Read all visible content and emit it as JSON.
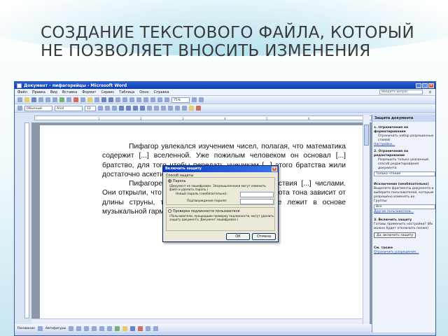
{
  "slide": {
    "title": "СОЗДАНИЕ ТЕКСТОВОГО ФАЙЛА, КОТОРЫЙ\nНЕ ПОЗВОЛЯЕТ ВНОСИТЬ ИЗМЕНЕНИЯ"
  },
  "word": {
    "window_title": "Документ - пифагорейцы - Microsoft Word",
    "menu": [
      "Файл",
      "Правка",
      "Вид",
      "Вставка",
      "Формат",
      "Сервис",
      "Таблица",
      "Окно",
      "Справка"
    ],
    "help_box": "Введите вопрос",
    "toolbar": {
      "zoom": "75%",
      "style": "Обычный",
      "font": "Arial",
      "size": "12"
    },
    "document_paragraphs": [
      "Пифагор увлекался изучением чисел, полагая, что математика содержит [...] вселенной. Уже пожилым человеком он основал [...] братство, для того чтобы передать ученикам [...] этого братства жили достаточно аскетично [...] занимались математикой.",
      "Пифагорейцы [...] и умели выполнять действия [...] числами. Они открыли, что в струнных инструментах [...] высота тона зависит от длины струны, т.е. математическое соотношение лежит в основе музыкальной гармонии."
    ],
    "drawing_bar": {
      "draw_label": "Рисование",
      "autoshapes_label": "Автофигуры"
    }
  },
  "task_pane": {
    "title": "Защита документа",
    "section1": "1. Ограничения на форматирование",
    "section1_checkbox": "Ограничить набор разрешенных стилей",
    "section1_link": "Настройки...",
    "section2": "2. Ограничения на редактирование",
    "section2_checkbox": "Разрешить только указанный способ редактирования документа:",
    "section2_select": "Только чтение",
    "exceptions_title": "Исключения (необязательно)",
    "exceptions_text": "Выделите фрагменты документа и выберите пользователей, которым разрешено изменять их.",
    "groups_label": "Группы:",
    "group_everyone": "Все",
    "more_users_link": "Другие пользователи...",
    "section3": "3. Включить защиту",
    "section3_text": "Готовы применить настройки? (Их можно будет отключить позже)",
    "enforce_button": "Да, включить защиту",
    "see_also": "См. также",
    "restrict_link": "Ограничить разрешения..."
  },
  "dialog": {
    "title": "Включить защиту",
    "group_label": "Способ защиты",
    "option_password": "Пароль",
    "password_note": "(Документ не зашифрован. Злоумышленники могут изменить файл и удалить пароль.)",
    "new_password_label": "Новый пароль (необязательно):",
    "confirm_password_label": "Подтверждение пароля:",
    "option_auth": "Проверка подлинности пользователя",
    "auth_note": "(Пользователи, прошедшие проверку подлинности, могут удалить защиту документа. Документ зашифрован.)",
    "ok_button": "ОК",
    "cancel_button": "Отмена"
  }
}
